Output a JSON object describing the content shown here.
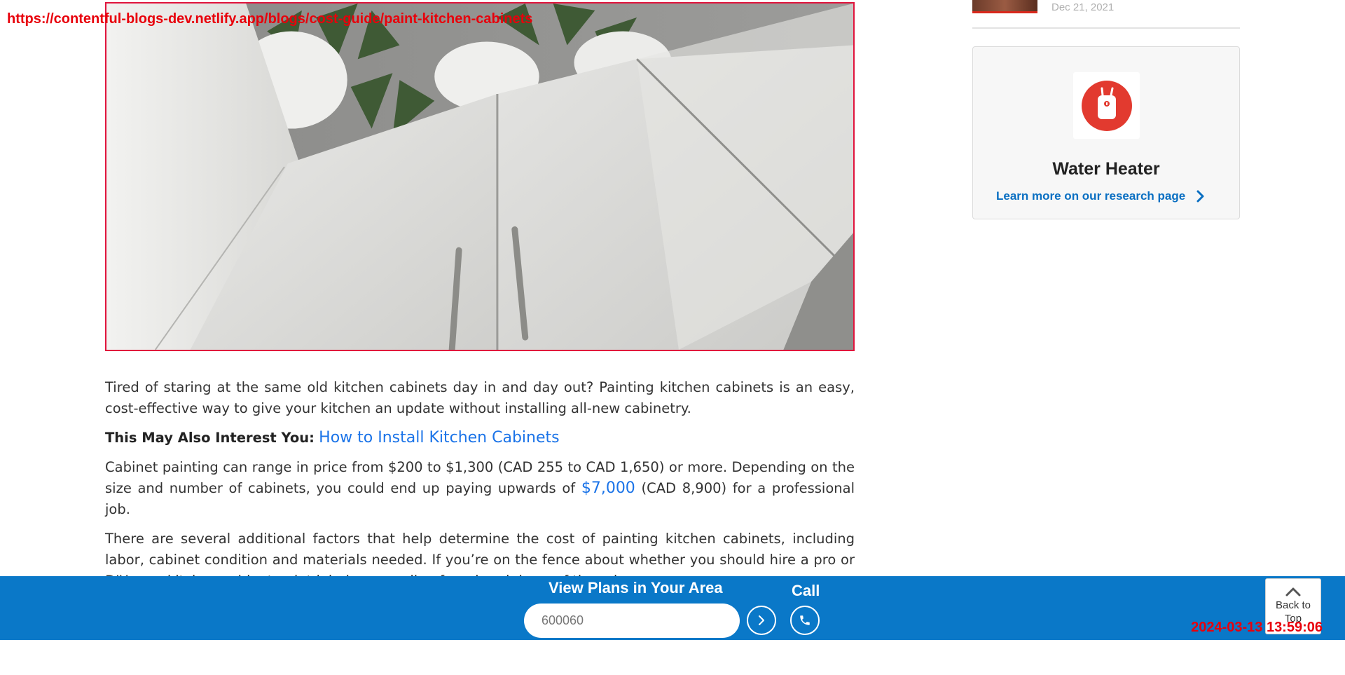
{
  "overlay": {
    "url": "https://contentful-blogs-dev.netlify.app/blogs/cost-guide/paint-kitchen-cabinets",
    "timestamp": "2024-03-13 13:59:06"
  },
  "sidebar": {
    "recent_post_date": "Dec 21, 2021",
    "research_card": {
      "icon": "water-heater-icon",
      "title": "Water Heater",
      "link_label": "Learn more on our research page"
    }
  },
  "article": {
    "intro": "Tired of staring at the same old kitchen cabinets day in and day out? Painting kitchen cabinets is an easy, cost-effective way to give your kitchen an update without installing all-new cabinetry.",
    "interest_label": "This May Also Interest You:",
    "interest_link": "How to Install Kitchen Cabinets",
    "cost_text_before": "Cabinet painting can range in price from $200 to $1,300 (CAD 255 to CAD 1,650) or more. Depending on the size and number of cabinets, you could end up paying upwards of",
    "cost_link": "$7,000",
    "cost_text_after": "(CAD 8,900) for a professional job.",
    "factors": "There are several additional factors that help determine the cost of painting kitchen cabinets, including labor, cabinet condition and materials needed. If you’re on the fence about whether you should hire a pro or DIY your kitchen cabinet paint job, keep reading for a breakdown of the price."
  },
  "bottom_bar": {
    "plans_title": "View Plans in Your Area",
    "zip_value": "600060",
    "call_label": "Call",
    "back_to_top_label": "Back to Top"
  },
  "colors": {
    "accent_blue": "#0a78c8",
    "link_blue": "#1a73e8",
    "brand_red": "#e23a2f"
  }
}
